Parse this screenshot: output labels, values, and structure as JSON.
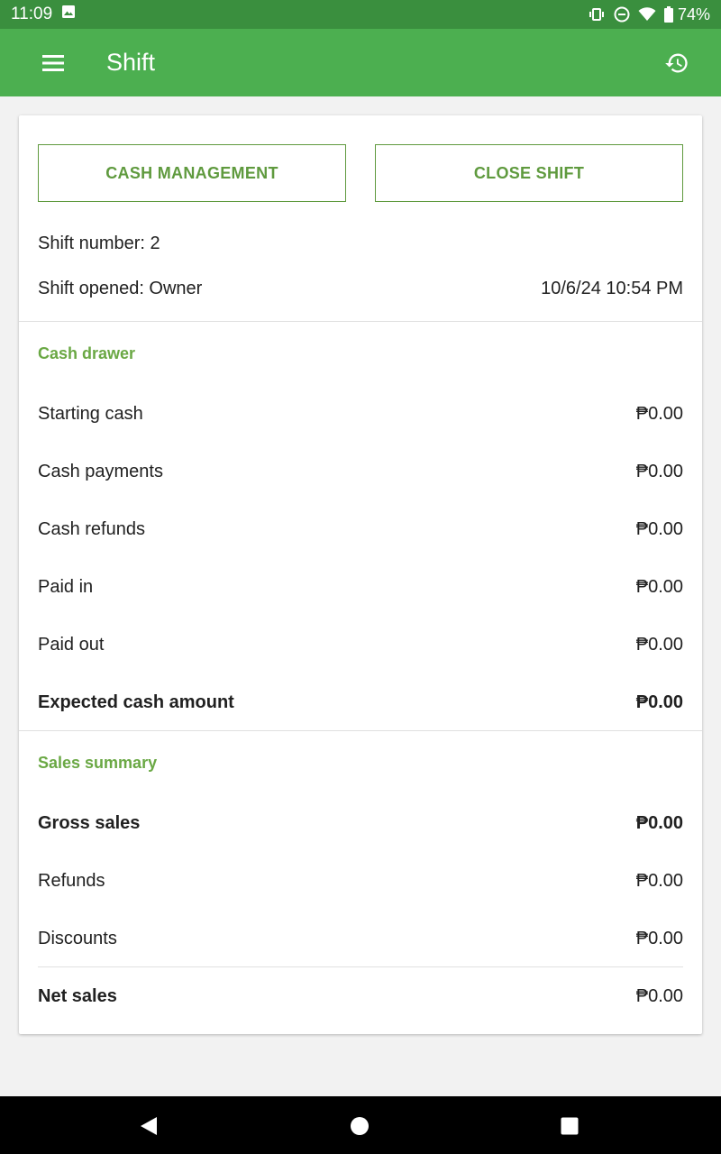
{
  "status_bar": {
    "time": "11:09",
    "battery": "74%"
  },
  "app_bar": {
    "title": "Shift"
  },
  "actions": {
    "cash_management": "CASH MANAGEMENT",
    "close_shift": "CLOSE SHIFT"
  },
  "shift": {
    "number_label": "Shift number: 2",
    "opened_label": "Shift opened: Owner",
    "opened_time": "10/6/24 10:54 PM"
  },
  "cash_drawer": {
    "title": "Cash drawer",
    "rows": [
      {
        "label": "Starting cash",
        "value": "₱0.00"
      },
      {
        "label": "Cash payments",
        "value": "₱0.00"
      },
      {
        "label": "Cash refunds",
        "value": "₱0.00"
      },
      {
        "label": "Paid in",
        "value": "₱0.00"
      },
      {
        "label": "Paid out",
        "value": "₱0.00"
      },
      {
        "label": "Expected cash amount",
        "value": "₱0.00"
      }
    ]
  },
  "sales_summary": {
    "title": "Sales summary",
    "rows": [
      {
        "label": "Gross sales",
        "value": "₱0.00"
      },
      {
        "label": "Refunds",
        "value": "₱0.00"
      },
      {
        "label": "Discounts",
        "value": "₱0.00"
      },
      {
        "label": "Net sales",
        "value": "₱0.00"
      }
    ]
  },
  "colors": {
    "status_bar": "#3a8f3e",
    "app_bar": "#4caf50",
    "accent": "#5f9a3e"
  }
}
